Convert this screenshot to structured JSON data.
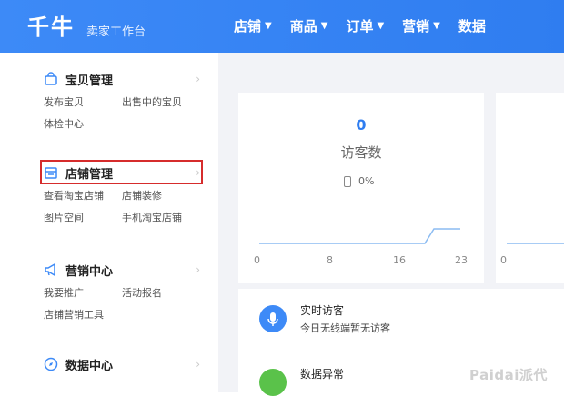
{
  "header": {
    "logo": "千牛",
    "subtitle": "卖家工作台",
    "nav": [
      {
        "label": "店铺"
      },
      {
        "label": "商品"
      },
      {
        "label": "订单"
      },
      {
        "label": "营销"
      },
      {
        "label": "数据"
      }
    ],
    "accent_color": "#2f7df0"
  },
  "sidebar": {
    "groups": [
      {
        "title": "宝贝管理",
        "icon": "shopping-bag-icon",
        "links": [
          "发布宝贝",
          "出售中的宝贝",
          "体检中心"
        ]
      },
      {
        "title": "店铺管理",
        "icon": "store-icon",
        "links": [
          "查看淘宝店铺",
          "店铺装修",
          "图片空间",
          "手机淘宝店铺"
        ],
        "highlighted": true
      },
      {
        "title": "营销中心",
        "icon": "megaphone-icon",
        "links": [
          "我要推广",
          "活动报名",
          "店铺营销工具"
        ]
      },
      {
        "title": "数据中心",
        "icon": "compass-icon",
        "links": []
      }
    ]
  },
  "visitor_card": {
    "value": "0",
    "label": "访客数",
    "mobile_pct": "0%",
    "chart_ticks": [
      "0",
      "8",
      "16",
      "23"
    ],
    "second_tick": "0"
  },
  "notifications": [
    {
      "title": "实时访客",
      "desc": "今日无线端暂无访客",
      "icon": "microphone-icon"
    },
    {
      "title": "数据异常",
      "icon": "data-icon"
    }
  ],
  "watermark": "Paidai派代"
}
